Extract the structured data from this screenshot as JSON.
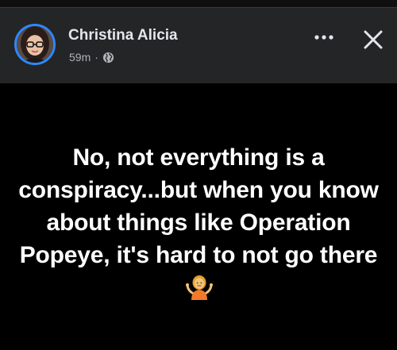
{
  "post": {
    "author": "Christina Alicia",
    "time": "59m",
    "separator": "·",
    "privacy_icon": "globe-icon",
    "text": "No, not everything is a conspiracy...but when you know about things like Operation Popeye, it's hard to not go there",
    "trailing_emoji": "person-shrugging-emoji"
  },
  "header": {
    "more_icon": "more-options-icon",
    "close_icon": "close-icon"
  },
  "colors": {
    "background": "#000000",
    "header_background": "#242526",
    "name_text": "#e4e6eb",
    "meta_text": "#b0b3b8",
    "post_text": "#ffffff",
    "avatar_ring": "#2d88ff"
  }
}
